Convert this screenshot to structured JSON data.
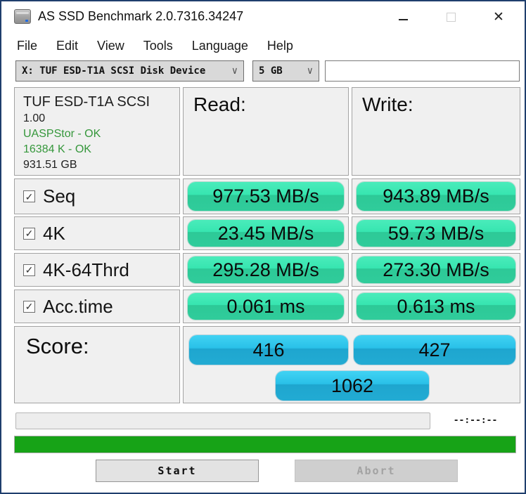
{
  "window": {
    "title": "AS SSD Benchmark 2.0.7316.34247"
  },
  "icons": {
    "app": "ssd-drive-icon",
    "minimize_glyph": "",
    "close_glyph": "✕",
    "chevron_down_glyph": "∨",
    "checkbox_checked_glyph": "✓"
  },
  "menu": {
    "file": "File",
    "edit": "Edit",
    "view": "View",
    "tools": "Tools",
    "language": "Language",
    "help": "Help"
  },
  "toolbar": {
    "drive_selected": "X: TUF ESD-T1A SCSI Disk Device",
    "size_selected": "5 GB",
    "textbox_value": ""
  },
  "info": {
    "model": "TUF ESD-T1A SCSI",
    "firmware": "1.00",
    "driver_status": "UASPStor - OK",
    "alignment_status": "16384 K - OK",
    "capacity": "931.51 GB"
  },
  "columns": {
    "read": "Read:",
    "write": "Write:"
  },
  "tests": [
    {
      "label": "Seq",
      "checked": true,
      "read": "977.53 MB/s",
      "write": "943.89 MB/s"
    },
    {
      "label": "4K",
      "checked": true,
      "read": "23.45 MB/s",
      "write": "59.73 MB/s"
    },
    {
      "label": "4K-64Thrd",
      "checked": true,
      "read": "295.28 MB/s",
      "write": "273.30 MB/s"
    },
    {
      "label": "Acc.time",
      "checked": true,
      "read": "0.061 ms",
      "write": "0.613 ms"
    }
  ],
  "score": {
    "label": "Score:",
    "read_score": "416",
    "write_score": "427",
    "total_score": "1062"
  },
  "progress": {
    "current_percent": 0,
    "overall_percent": 100,
    "time_remaining": "--:--:--"
  },
  "buttons": {
    "start": "Start",
    "abort": "Abort"
  },
  "colors": {
    "value_pill_green_top": "#37e5b0",
    "value_pill_green_bottom": "#2dc997",
    "score_pill_blue_top": "#29c0e8",
    "score_pill_blue_bottom": "#1ea6cf",
    "overall_bar_green": "#17a317",
    "ok_text_green": "#35973b",
    "window_border_blue": "#1f3e6d"
  }
}
